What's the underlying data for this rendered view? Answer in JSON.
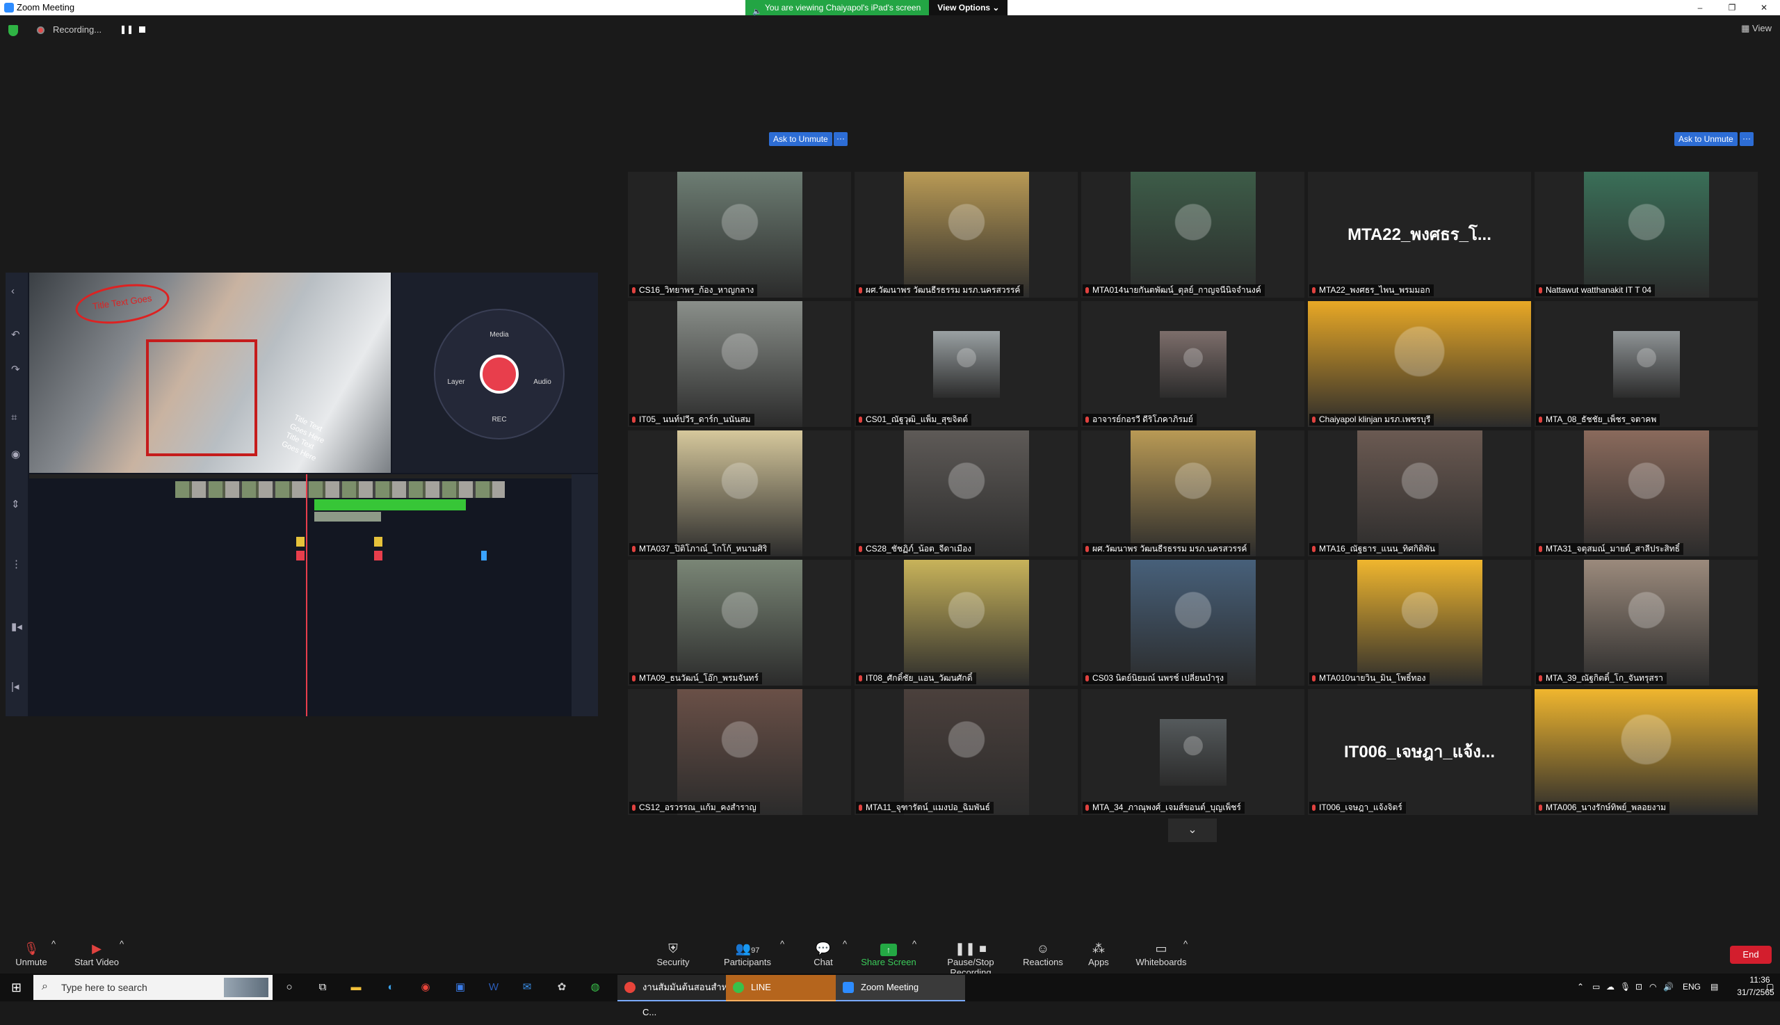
{
  "window": {
    "title": "Zoom Meeting",
    "buttons": {
      "minimize": "–",
      "restore": "❐",
      "close": "✕"
    }
  },
  "banner": {
    "viewing_text": "You are viewing Chaiyapol's iPad's screen",
    "view_options": "View Options ⌄"
  },
  "meeting": {
    "recording_text": "Recording...",
    "pause_icon": "❚❚",
    "view_label": "View"
  },
  "shared_screen": {
    "sticker_text": "Title Text Goes",
    "caption_lines": "Title Text\nGoes Here\nTitle Text\nGoes Here",
    "wheel": {
      "media": "Media",
      "layer": "Layer",
      "audio": "Audio",
      "rec": "REC"
    }
  },
  "participants": [
    {
      "name": "CS16_วิทยาพร_ก้อง_หาญกลาง",
      "kind": "video",
      "bg": "#6d7d73"
    },
    {
      "name": "ผศ.วัฒนาพร วัฒนธีรธรรม มรภ.นครสวรรค์",
      "kind": "video",
      "bg": "#b99a55"
    },
    {
      "name": "MTA014นายกันตพัฒน์_ตุลย์_กาญจนีนิจจำนงค์",
      "kind": "video",
      "bg": "#3d5c48"
    },
    {
      "name": "MTA22_พงศธร_ไพน_พรมมอก",
      "kind": "name",
      "big": "MTA22_พงศธร_โ..."
    },
    {
      "name": "Nattawut watthanakit IT T 04",
      "kind": "video",
      "bg": "#3a6f58"
    },
    {
      "name": "IT05_ นนท์ปวีร_ดาร์ก_นนันสม",
      "kind": "video",
      "bg": "#8a8f8a"
    },
    {
      "name": "CS01_ณัฐวุฒิ_แพ็ม_สุขจิตต์",
      "kind": "video",
      "bg": "#9aa1a3"
    },
    {
      "name": "อาจารย์กอรวี ดีริโภคาภิรมย์",
      "kind": "video",
      "bg": "#7d6e6b"
    },
    {
      "name": "Chaiyapol klinjan มรภ.เพชรบุรี",
      "kind": "video",
      "bg": "#e8a826"
    },
    {
      "name": "MTA_08_ธัชชัย_เพ็ชร_จตาคพ",
      "kind": "video",
      "bg": "#8f9496"
    },
    {
      "name": "MTA037_ปิติโภาณ์_โกโก้_หนามศิริ",
      "kind": "video",
      "bg": "#d6c89c"
    },
    {
      "name": "CS28_ชัชฏิภ์_น้อต_จีดาเมือง",
      "kind": "video",
      "bg": "#5e5a57"
    },
    {
      "name": "ผศ.วัฒนาพร วัฒนธีรธรรม มรภ.นครสวรรค์",
      "kind": "video",
      "bg": "#b99a55"
    },
    {
      "name": "MTA16_ณัฐธาร_แนน_ทิศกิดิพัน",
      "kind": "video",
      "bg": "#6b5a52"
    },
    {
      "name": "MTA31_จตุสมณ์_มายด์_สาลีประสิทธิ์",
      "kind": "video",
      "bg": "#8a6a5c"
    },
    {
      "name": "MTA09_ธนวัฒน์_โอ๊ก_พรมจันทร์",
      "kind": "video",
      "bg": "#7a8676"
    },
    {
      "name": "IT08_ศักดิ์ชัย_แอน_วัฒนศักดิ์",
      "kind": "video",
      "bg": "#c8b35a"
    },
    {
      "name": "CS03 นิตย์นิยมณ์ นพรช์ เปลี่ยนบำรุง",
      "kind": "video",
      "bg": "#47607a"
    },
    {
      "name": "MTA010นายวิน_มิน_โพธิ์ทอง",
      "kind": "video",
      "bg": "#f0b62e"
    },
    {
      "name": "MTA_39_ณัฐกิตติ์_โก_จันทรุสรา",
      "kind": "video",
      "bg": "#9b8a7c"
    },
    {
      "name": "CS12_อรวรรณ_แก้ม_คงสำราญ",
      "kind": "video",
      "bg": "#6a5047"
    },
    {
      "name": "MTA11_จุฑารัตน์_แมงปอ_ฉิมพันธ์",
      "kind": "video",
      "bg": "#4b403c"
    },
    {
      "name": "MTA_34_ภาณุพงศ์_เจมส์ขอนต์_บุญเพ็ชร์",
      "kind": "video",
      "bg": "#555a5c"
    },
    {
      "name": "IT006_เจษฎา_แจ้งจิตร์",
      "kind": "name",
      "big": "IT006_เจษฎา_แจ้ง..."
    },
    {
      "name": "MTA006_นางรักษ์ทิพย์_พลอยงาม",
      "kind": "video",
      "bg": "#f0b62e"
    }
  ],
  "ask_unmute": {
    "label": "Ask to Unmute",
    "more": "···"
  },
  "toolbar": {
    "unmute": "Unmute",
    "start_video": "Start Video",
    "security": "Security",
    "participants": "Participants",
    "participants_count": "97",
    "chat": "Chat",
    "share_screen": "Share Screen",
    "pause_stop_recording": "Pause/Stop Recording",
    "reactions": "Reactions",
    "apps": "Apps",
    "whiteboards": "Whiteboards",
    "end": "End",
    "caret": "^"
  },
  "taskbar": {
    "search_placeholder": "Type here to search",
    "apps": [
      {
        "label": "งานสัมมนาเชิงปฏิบัติการ...",
        "short": "งานสัมมันต้นสอนสำหรับ C..."
      },
      {
        "label": "LINE"
      },
      {
        "label": "Zoom Meeting"
      }
    ],
    "lang": "ENG",
    "time": "11:36",
    "date": "31/7/2565"
  }
}
